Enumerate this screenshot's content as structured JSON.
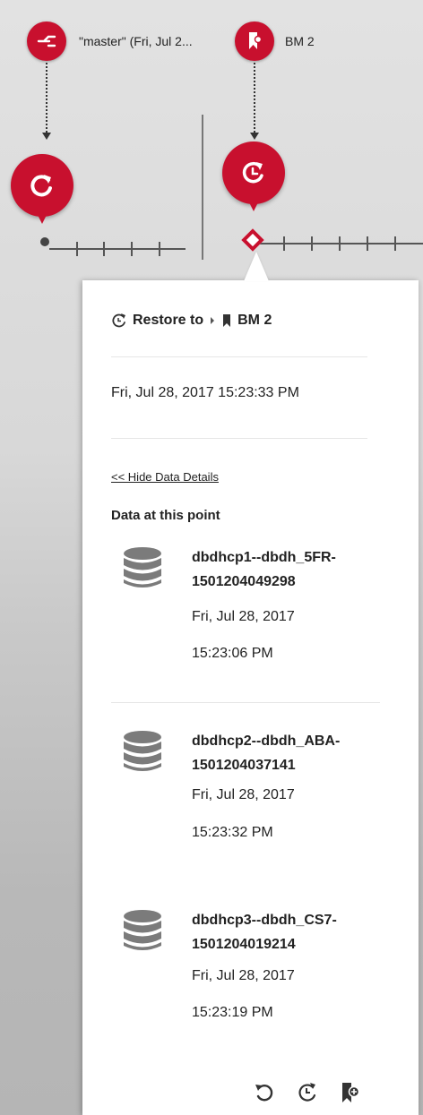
{
  "timeline": {
    "markers": [
      {
        "label": "\"master\" (Fri, Jul 2...",
        "icon": "branch-icon"
      },
      {
        "label": "BM 2",
        "icon": "bookmark-icon"
      }
    ],
    "accent_color": "#c8102e"
  },
  "popover": {
    "restore_label": "Restore to",
    "restore_target": "BM 2",
    "timestamp": "Fri, Jul 28, 2017 15:23:33 PM",
    "hide_link": "<< Hide Data Details",
    "data_heading": "Data at this point",
    "datasets": [
      {
        "name_line1": "dbdhcp1--dbdh_5FR-",
        "name_line2": "1501204049298",
        "date": "Fri, Jul 28, 2017",
        "time": "15:23:06 PM"
      },
      {
        "name_line1": "dbdhcp2--dbdh_ABA-",
        "name_line2": "1501204037141",
        "date": "Fri, Jul 28, 2017",
        "time": "15:23:32 PM"
      },
      {
        "name_line1": "dbdhcp3--dbdh_CS7-",
        "name_line2": "1501204019214",
        "date": "Fri, Jul 28, 2017",
        "time": "15:23:19 PM"
      }
    ],
    "actions": [
      "undo-icon",
      "restore-clock-icon",
      "bookmark-add-icon"
    ]
  }
}
